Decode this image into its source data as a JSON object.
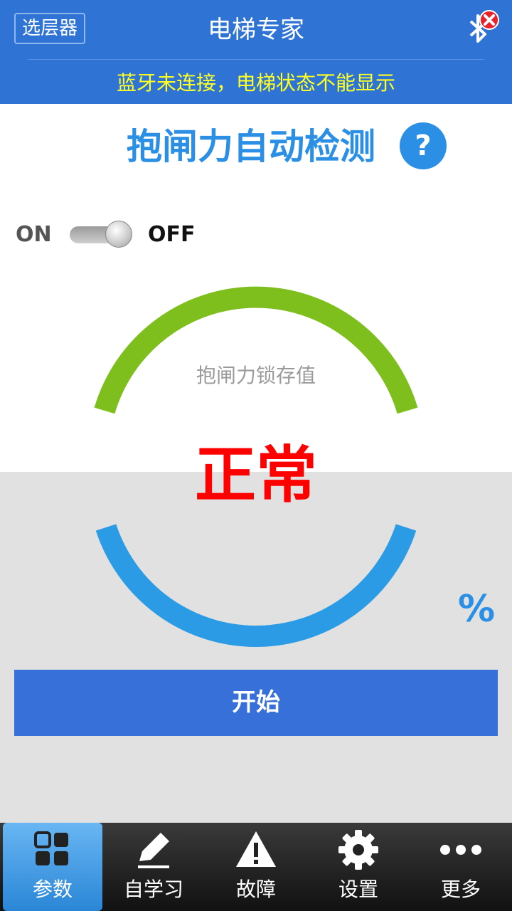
{
  "header": {
    "layer_button": "选层器",
    "title": "电梯专家",
    "bluetooth_status": "蓝牙未连接，电梯状态不能显示",
    "bluetooth_icon": "bluetooth-disconnected-icon"
  },
  "section": {
    "title": "抱闸力自动检测",
    "help_label": "?"
  },
  "toggle": {
    "on_label": "ON",
    "off_label": "OFF",
    "state": "off"
  },
  "gauge": {
    "label": "抱闸力锁存值",
    "status": "正常",
    "unit": "%",
    "colors": {
      "upper_arc": "#7fbf1d",
      "lower_arc": "#2b9be6",
      "status": "#ff0000"
    }
  },
  "actions": {
    "start_label": "开始"
  },
  "tabs": [
    {
      "label": "参数",
      "icon": "grid-icon",
      "active": true
    },
    {
      "label": "自学习",
      "icon": "pencil-icon",
      "active": false
    },
    {
      "label": "故障",
      "icon": "warning-icon",
      "active": false
    },
    {
      "label": "设置",
      "icon": "gear-icon",
      "active": false
    },
    {
      "label": "更多",
      "icon": "more-dots-icon",
      "active": false
    }
  ],
  "colors": {
    "header_bg": "#2f74d4",
    "accent": "#2b8fe6",
    "button_bg": "#3670d8",
    "warning_text": "#ffff22"
  }
}
